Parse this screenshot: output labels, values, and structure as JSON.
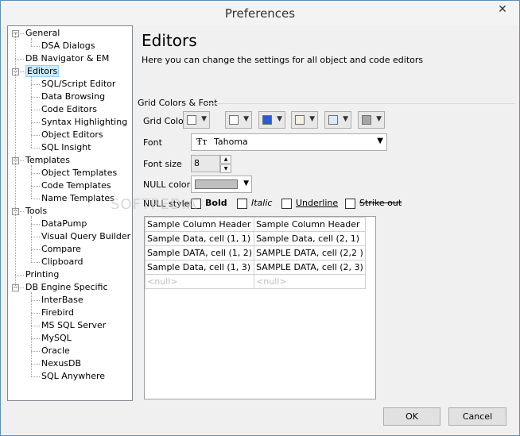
{
  "window": {
    "title": "Preferences",
    "close": "✕"
  },
  "tree": {
    "items": [
      {
        "label": "General",
        "level": 0,
        "expanded": true
      },
      {
        "label": "DSA Dialogs",
        "level": 1
      },
      {
        "label": "DB Navigator & EM",
        "level": 0
      },
      {
        "label": "Editors",
        "level": 0,
        "expanded": true,
        "selected": true
      },
      {
        "label": "SQL/Script Editor",
        "level": 1
      },
      {
        "label": "Data Browsing",
        "level": 1
      },
      {
        "label": "Code Editors",
        "level": 1
      },
      {
        "label": "Syntax Highlighting",
        "level": 1
      },
      {
        "label": "Object Editors",
        "level": 1
      },
      {
        "label": "SQL Insight",
        "level": 1
      },
      {
        "label": "Templates",
        "level": 0,
        "expanded": true
      },
      {
        "label": "Object Templates",
        "level": 1
      },
      {
        "label": "Code Templates",
        "level": 1
      },
      {
        "label": "Name Templates",
        "level": 1
      },
      {
        "label": "Tools",
        "level": 0,
        "expanded": true
      },
      {
        "label": "DataPump",
        "level": 1
      },
      {
        "label": "Visual Query Builder",
        "level": 1
      },
      {
        "label": "Compare",
        "level": 1
      },
      {
        "label": "Clipboard",
        "level": 1
      },
      {
        "label": "Printing",
        "level": 0
      },
      {
        "label": "DB Engine Specific",
        "level": 0,
        "expanded": true
      },
      {
        "label": "InterBase",
        "level": 1
      },
      {
        "label": "Firebird",
        "level": 1
      },
      {
        "label": "MS SQL Server",
        "level": 1
      },
      {
        "label": "MySQL",
        "level": 1
      },
      {
        "label": "Oracle",
        "level": 1
      },
      {
        "label": "NexusDB",
        "level": 1
      },
      {
        "label": "SQL Anywhere",
        "level": 1
      }
    ]
  },
  "content": {
    "heading": "Editors",
    "subtitle": "Here you can change the settings for all object and code editors",
    "group_title": "Grid Colors & Font",
    "grid_colors_label": "Grid Colors",
    "grid_colors": [
      "#ffffff",
      "#ffffff",
      "#2a5bd7",
      "#f5f0e1",
      "#dbeaf8",
      "#a6a6a6"
    ],
    "font_label": "Font",
    "font_icon": "Ŧт",
    "font_value": "Tahoma",
    "font_size_label": "Font size",
    "font_size_value": "8",
    "null_color_label": "NULL color",
    "null_color": "#c0c0c0",
    "null_style_label": "NULL style",
    "styles": {
      "bold": "Bold",
      "italic": "Italic",
      "underline": "Underline",
      "strikeout": "Strike out"
    }
  },
  "sample_grid": {
    "headers": [
      "Sample Column Header",
      "Sample Column Header"
    ],
    "rows": [
      [
        "Sample Data, cell (1, 1)",
        "Sample Data, cell (2, 1)"
      ],
      [
        "Sample DATA, cell (1, 2)",
        "SAMPLE DATA, cell (2,2 )"
      ],
      [
        "Sample Data, cell (1, 3)",
        "SAMPLE DATA, cell (2, 3)"
      ],
      [
        "<null>",
        "<null>"
      ]
    ]
  },
  "watermark": "SOFTPEDIA",
  "buttons": {
    "ok": "OK",
    "cancel": "Cancel"
  }
}
